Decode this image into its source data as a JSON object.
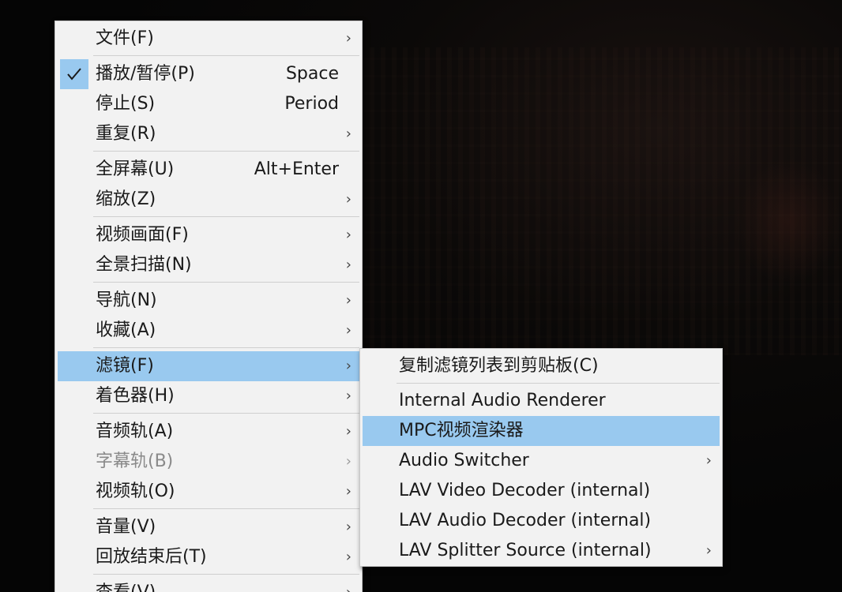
{
  "main_menu": {
    "items": [
      {
        "label": "文件(F)",
        "shortcut": "",
        "submenu": true
      },
      {
        "label": "播放/暂停(P)",
        "shortcut": "Space",
        "submenu": false,
        "checked": true
      },
      {
        "label": "停止(S)",
        "shortcut": "Period",
        "submenu": false
      },
      {
        "label": "重复(R)",
        "shortcut": "",
        "submenu": true
      },
      {
        "label": "全屏幕(U)",
        "shortcut": "Alt+Enter",
        "submenu": false
      },
      {
        "label": "缩放(Z)",
        "shortcut": "",
        "submenu": true
      },
      {
        "label": "视频画面(F)",
        "shortcut": "",
        "submenu": true
      },
      {
        "label": "全景扫描(N)",
        "shortcut": "",
        "submenu": true
      },
      {
        "label": "导航(N)",
        "shortcut": "",
        "submenu": true
      },
      {
        "label": "收藏(A)",
        "shortcut": "",
        "submenu": true
      },
      {
        "label": "滤镜(F)",
        "shortcut": "",
        "submenu": true,
        "highlighted": true
      },
      {
        "label": "着色器(H)",
        "shortcut": "",
        "submenu": true
      },
      {
        "label": "音频轨(A)",
        "shortcut": "",
        "submenu": true
      },
      {
        "label": "字幕轨(B)",
        "shortcut": "",
        "submenu": true,
        "disabled": true
      },
      {
        "label": "视频轨(O)",
        "shortcut": "",
        "submenu": true
      },
      {
        "label": "音量(V)",
        "shortcut": "",
        "submenu": true
      },
      {
        "label": "回放结束后(T)",
        "shortcut": "",
        "submenu": true
      },
      {
        "label": "查看(V)",
        "shortcut": "",
        "submenu": true
      }
    ]
  },
  "filters_submenu": {
    "items": [
      {
        "label": "复制滤镜列表到剪贴板(C)",
        "submenu": false
      },
      {
        "label": "Internal Audio Renderer",
        "submenu": false
      },
      {
        "label": "MPC视频渲染器",
        "submenu": false,
        "highlighted": true
      },
      {
        "label": "Audio Switcher",
        "submenu": true
      },
      {
        "label": "LAV Video Decoder (internal)",
        "submenu": false
      },
      {
        "label": "LAV Audio Decoder (internal)",
        "submenu": false
      },
      {
        "label": "LAV Splitter Source (internal)",
        "submenu": true
      }
    ]
  },
  "icons": {
    "submenu_arrow": "chevron-right-icon",
    "checked": "checkmark-icon"
  },
  "colors": {
    "menu_background": "#f2f2f2",
    "highlight": "#99c9ef",
    "disabled_text": "#8a8a8a"
  }
}
